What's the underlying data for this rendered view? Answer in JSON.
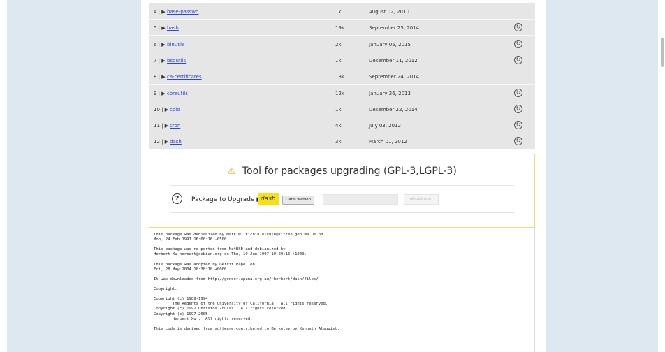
{
  "packages": [
    {
      "num": "4 |",
      "name": "base-passwd",
      "size": "1k",
      "date": "August 02, 2010",
      "refresh": false
    },
    {
      "num": "5 |",
      "name": "bash",
      "size": "19k",
      "date": "September 25, 2014",
      "refresh": true
    },
    {
      "num": "6 |",
      "name": "binutils",
      "size": "2k",
      "date": "January 05, 2015",
      "refresh": true
    },
    {
      "num": "7 |",
      "name": "bsdutils",
      "size": "1k",
      "date": "December 11, 2012",
      "refresh": true
    },
    {
      "num": "8 |",
      "name": "ca-certificates",
      "size": "18k",
      "date": "September 24, 2014",
      "refresh": false
    },
    {
      "num": "9 |",
      "name": "coreutils",
      "size": "12k",
      "date": "January 26, 2013",
      "refresh": true
    },
    {
      "num": "10 |",
      "name": "cpio",
      "size": "1k",
      "date": "December 22, 2014",
      "refresh": true
    },
    {
      "num": "11 |",
      "name": "cron",
      "size": "4k",
      "date": "July 03, 2012",
      "refresh": true
    },
    {
      "num": "12 |",
      "name": "dash",
      "size": "3k",
      "date": "March 01, 2012",
      "refresh": true
    }
  ],
  "row_arrow": "▶",
  "refresh_glyph": "↻",
  "tool": {
    "title": "Tool for packages upgrading (GPL-3,LGPL-3)",
    "warning_icon": "⚠",
    "help_icon": "?",
    "label": "Package to Upgrade ▶",
    "package": "dash",
    "file_button": "Datei wählen",
    "submit_button": "Aktualisieren"
  },
  "license_text": "This package was debianized by Mark W. Eichin eichin@kitten.gen.ma.us on\nMon, 24 Feb 1997 16:00:16 -0500.\n\nThis package was re-ported from NetBSD and debianized by\nHerbert Xu herbert@debian.org on Thu, 19 Jun 1997 19:29:16 +1000.\n\nThis package was adopted by Gerrit Pape  on\nFri, 28 May 2004 18:38:18 +0000.\n\nIt was downloaded from http://gondor.apana.org.au/~herbert/dash/files/\n\nCopyright:\n\nCopyright (c) 1989-1994\n        The Regents of the University of California.  All rights reserved.\nCopyright (c) 1997 Christos Zoulas.  All rights reserved.\nCopyright (c) 1997-2005\n        Herbert Xu .  All rights reserved.\n\nThis code is derived from software contributed to Berkeley by Kenneth Almquist.",
  "colors": {
    "side_panel": "#dde8f0",
    "row_bg": "#e6e6e6",
    "link": "#2a4bd7",
    "tool_border": "#f0dd6a",
    "package_highlight": "#f7e014",
    "warning": "#e2a700"
  }
}
